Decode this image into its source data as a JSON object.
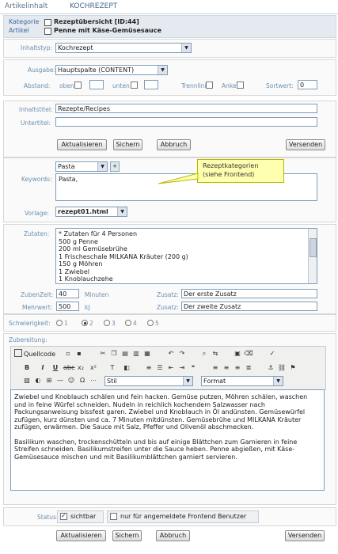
{
  "tabs": {
    "article_content": "Artikelinhalt",
    "kochrezept": "KOCHREZEPT"
  },
  "breadcrumb": {
    "category_label": "Kategorie",
    "category_value": "Rezeptübersicht [ID:44]",
    "article_label": "Artikel",
    "article_value": "Penne mit Käse-Gemüsesauce"
  },
  "form": {
    "inhaltstyp_label": "Inhaltstyp:",
    "inhaltstyp_value": "Kochrezept",
    "ausgabe_label": "Ausgabe:",
    "ausgabe_value": "Hauptspalte (CONTENT)",
    "abstand_label": "Abstand:",
    "oben_label": "oben",
    "unten_label": "unten",
    "trennlinie_label": "Trennlinie:",
    "anker_label": "Anker:",
    "sortwert_label": "Sortwert:",
    "sortwert_value": "0",
    "inhaltstitel_label": "Inhaltstitel:",
    "inhaltstitel_value": "Rezepte/Recipes",
    "untertitel_label": "Untertitel:",
    "untertitel_value": "",
    "keywords_label": "Keywords:",
    "keywords_select": "Pasta",
    "keywords_value": "Pasta,",
    "tooltip_line1": "Rezeptkategorien",
    "tooltip_line2": "(siehe Frontend)",
    "vorlage_label": "Vorlage:",
    "vorlage_value": "rezept01.html",
    "zutaten_label": "Zutaten:",
    "zutaten_lines": [
      "* Zutaten für 4 Personen",
      "500 g Penne",
      "200 ml Gemüsebrühe",
      "1 Frischeschale MILKANA Kräuter (200 g)",
      "150 g Möhren",
      "1 Zwiebel",
      "1 Knoblauchzehe"
    ],
    "zubereit_label": "ZubenZeit:",
    "zubereit_value": "40",
    "zubereit_unit": "Minuten",
    "zusatz_label": "Zusatz:",
    "zusatz1_value": "Der erste Zusatz",
    "mehrwert_label": "Mehrwert:",
    "mehrwert_value": "500",
    "mehrwert_unit": "kJ",
    "zusatz2_value": "Der zweite Zusatz",
    "schwierigkeit_label": "Schwierigkeit:",
    "schwierigkeit_options": [
      "1",
      "2",
      "3",
      "4",
      "5"
    ],
    "zubereitung_label": "Zubereitung:",
    "quellcode_label": "Quellcode",
    "stil_label": "Stil",
    "format_label": "Format",
    "editor_para1": "Zwiebel und Knoblauch schälen und fein hacken. Gemüse putzen, Möhren schälen, waschen und in feine Würfel schneiden. Nudeln in reichlich kochendem Salzwasser nach Packungsanweisung bissfest garen. Zwiebel und Knoblauch in Öl andünsten. Gemüsewürfel zufügen, kurz dünsten und ca. 7 Minuten mitdünsten. Gemüsebrühe und MILKANA Kräuter zufügen, erwärmen. Die Sauce mit Salz, Pfeffer und Olivenöl abschmecken.",
    "editor_para2": "Basilikum waschen, trockenschütteln und bis auf einige Blättchen zum Garnieren in feine Streifen schneiden. Basilikumstreifen unter die Sauce heben. Penne abgießen, mit Käse-Gemüsesauce mischen und mit Basilikumblättchen garniert servieren.",
    "status_label": "Status:",
    "sichtbar_label": "sichtbar",
    "frontend_label": "nur für angemeldete Frontend Benutzer"
  },
  "buttons": {
    "aktualisieren": "Aktualisieren",
    "sichern": "Sichern",
    "abbruch": "Abbruch",
    "versenden": "Versenden"
  }
}
